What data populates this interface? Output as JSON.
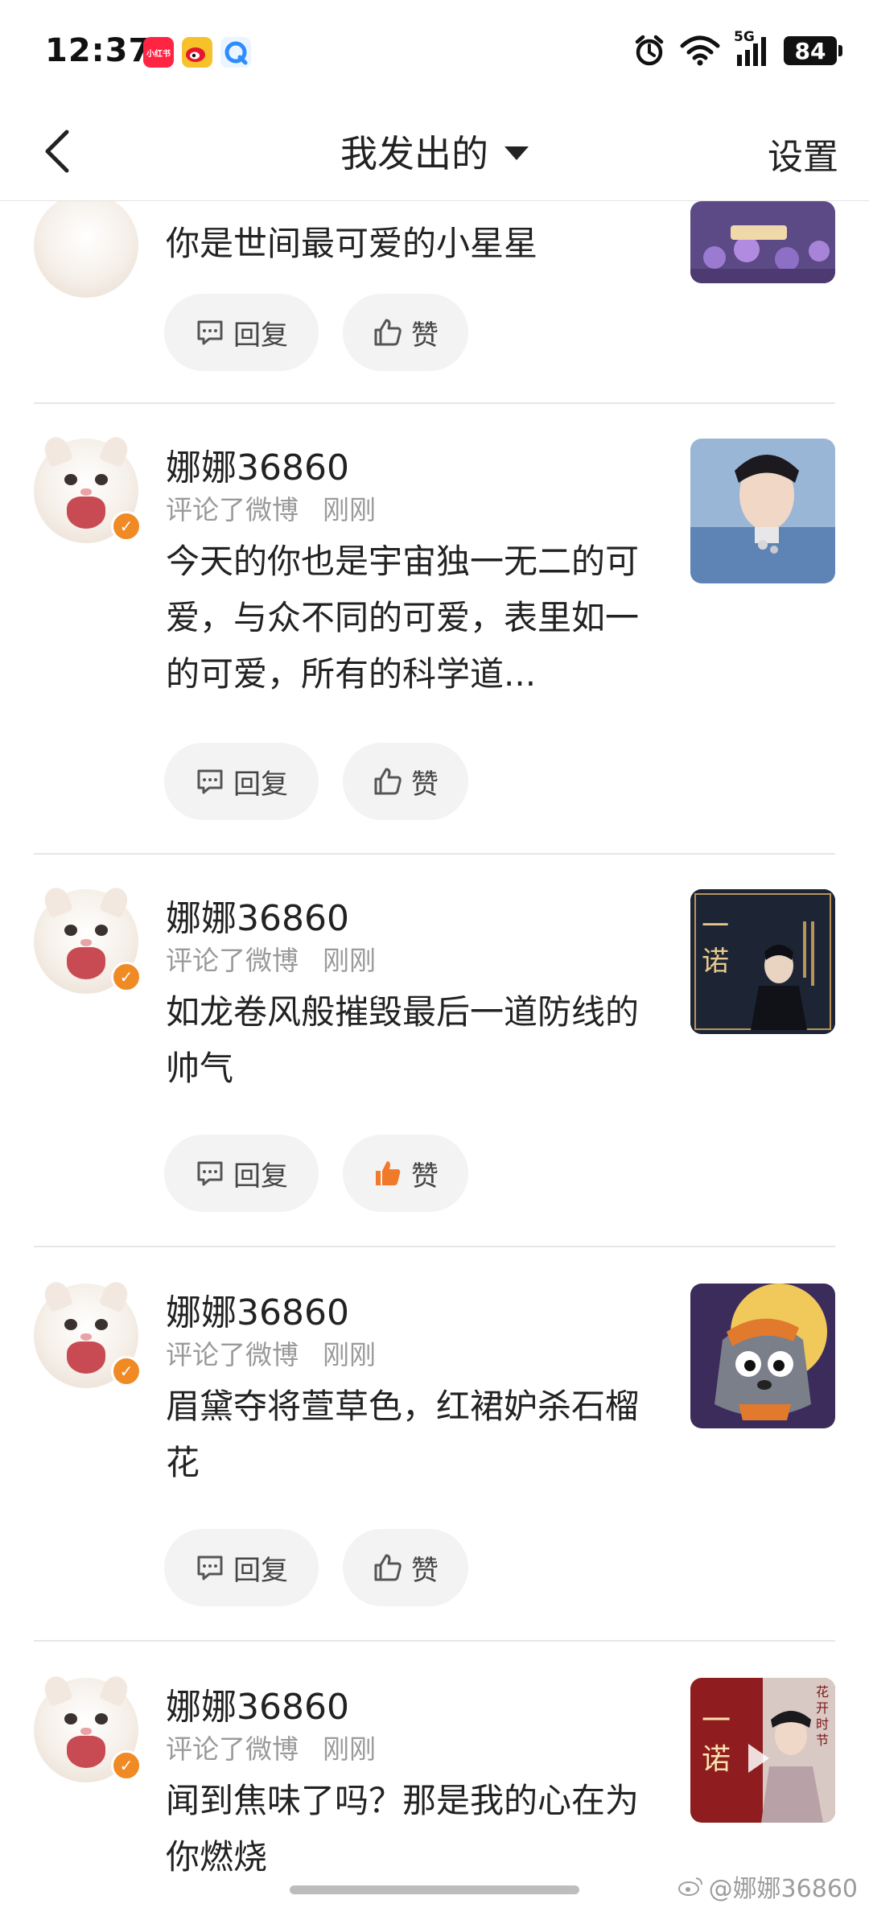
{
  "status_bar": {
    "time": "12:37",
    "apps": [
      "xiaohongshu-icon",
      "weibo-icon",
      "qq-browser-icon"
    ],
    "app_badge_text": "小红书",
    "network": "5G",
    "battery": "84"
  },
  "nav": {
    "title": "我发出的",
    "settings": "设置"
  },
  "actions": {
    "reply": "回复",
    "like": "赞"
  },
  "items": [
    {
      "username": "",
      "action": "",
      "time": "",
      "content": "你是世间最可爱的小星星",
      "liked": false
    },
    {
      "username": "娜娜36860",
      "action": "评论了微博",
      "time": "刚刚",
      "content": "今天的你也是宇宙独一无二的可爱，与众不同的可爱，表里如一的可爱，所有的科学道...",
      "liked": false
    },
    {
      "username": "娜娜36860",
      "action": "评论了微博",
      "time": "刚刚",
      "content": "如龙卷风般摧毁最后一道防线的帅气",
      "liked": true
    },
    {
      "username": "娜娜36860",
      "action": "评论了微博",
      "time": "刚刚",
      "content": "眉黛夺将萱草色，红裙妒杀石榴花",
      "liked": false
    },
    {
      "username": "娜娜36860",
      "action": "评论了微博",
      "time": "刚刚",
      "content": "闻到焦味了吗？那是我的心在为你燃烧",
      "liked": false
    }
  ],
  "thumb_text": {
    "item3": "一诺",
    "item5": "一诺",
    "item5_side": "花开时节"
  },
  "watermark": "@娜娜36860",
  "colors": {
    "accent": "#f08a24",
    "like_active": "#f07a2a",
    "meta": "#9a9a9a"
  }
}
